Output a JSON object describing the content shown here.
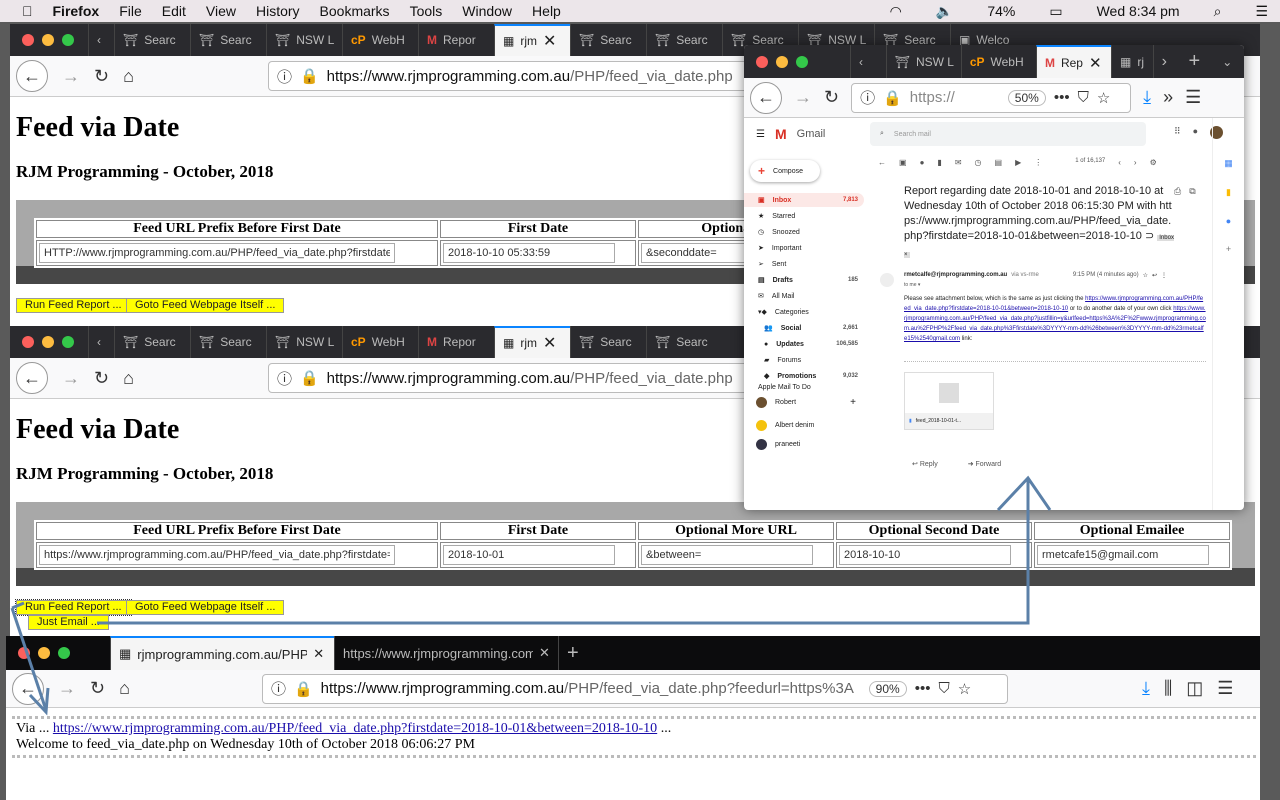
{
  "menubar": {
    "apple": "",
    "app": "Firefox",
    "items": [
      "File",
      "Edit",
      "View",
      "History",
      "Bookmarks",
      "Tools",
      "Window",
      "Help"
    ],
    "battery": "74%",
    "clock": "Wed 8:34 pm"
  },
  "colors": {
    "highlight_buttons": "#ffff00",
    "arrow": "#5b80a8",
    "tabbar": "#2a2a2e",
    "lock": "#12bc00"
  },
  "win1": {
    "tabs": [
      "Searc",
      "Searc",
      "NSW L",
      "WebH",
      "Repor",
      "rjm",
      "Searc",
      "Searc",
      "Searc",
      "NSW L",
      "Searc",
      "Welco"
    ],
    "url_host": "https://www.rjmprogramming.com.au",
    "url_path": "/PHP/feed_via_date.php",
    "title": "Feed via Date",
    "subtitle": "RJM Programming - October, 2018",
    "headers": [
      "Feed URL Prefix Before First Date",
      "First Date",
      "Optional M"
    ],
    "values": [
      "HTTP://www.rjmprogramming.com.au/PHP/feed_via_date.php?firstdate=",
      "2018-10-10 05:33:59",
      "&seconddate="
    ],
    "run": "Run Feed Report ...",
    "goto": "Goto Feed Webpage Itself ..."
  },
  "win2": {
    "tabs": [
      "Searc",
      "Searc",
      "NSW L",
      "WebH",
      "Repor",
      "rjm",
      "Searc",
      "Searc"
    ],
    "url_host": "https://www.rjmprogramming.com.au",
    "url_path": "/PHP/feed_via_date.php",
    "title": "Feed via Date",
    "subtitle": "RJM Programming - October, 2018",
    "headers": [
      "Feed URL Prefix Before First Date",
      "First Date",
      "Optional More URL",
      "Optional Second Date",
      "Optional Emailee"
    ],
    "values": [
      "https://www.rjmprogramming.com.au/PHP/feed_via_date.php?firstdate=",
      "2018-10-01",
      "&between=",
      "2018-10-10",
      "rmetcafe15@gmail.com"
    ],
    "run": "Run Feed Report ...",
    "goto": "Goto Feed Webpage Itself ...",
    "email": "Just Email ..."
  },
  "win3": {
    "tabs": [
      "rjmprogramming.com.au/PHP/fe",
      "https://www.rjmprogramming.com.a"
    ],
    "url_host": "https://www.rjmprogramming.com.au",
    "url_path": "/PHP/feed_via_date.php?feedurl=https%3A",
    "zoom": "90%",
    "via": "Via ...",
    "link": "https://www.rjmprogramming.com.au/PHP/feed_via_date.php?firstdate=2018-10-01&between=2018-10-10",
    "ellipsis": "...",
    "welcome": "Welcome to feed_via_date.php on Wednesday 10th of October 2018 06:06:27 PM"
  },
  "gmail": {
    "tabs": [
      "NSW L",
      "WebH",
      "Rep",
      "rj"
    ],
    "url": "https://",
    "zoom": "50%",
    "brand": "Gmail",
    "search_placeholder": "Search mail",
    "compose": "Compose",
    "nav": [
      {
        "label": "Inbox",
        "count": "7,813"
      },
      {
        "label": "Starred"
      },
      {
        "label": "Snoozed"
      },
      {
        "label": "Important"
      },
      {
        "label": "Sent"
      },
      {
        "label": "Drafts",
        "count": "185"
      },
      {
        "label": "All Mail"
      },
      {
        "label": "Categories"
      },
      {
        "label": "Social",
        "count": "2,661"
      },
      {
        "label": "Updates",
        "count": "106,585"
      },
      {
        "label": "Forums"
      },
      {
        "label": "Promotions",
        "count": "9,032"
      },
      {
        "label": "Apple Mail To Do"
      }
    ],
    "contacts": [
      "Robert",
      "Albert denim",
      "praneeti"
    ],
    "pager": "1 of 16,137",
    "subject": "Report regarding date 2018-10-01 and 2018-10-10 at Wednesday 10th of October 2018 06:15:30 PM with https://www.rjmprogramming.com.au/PHP/feed_via_date.php?firstdate=2018-10-01&between=2018-10-10",
    "label": "Inbox ×",
    "sender": "rmetcalfe@rjmprogramming.com.au",
    "via": "via vs-rme",
    "time": "9:15 PM (4 minutes ago)",
    "to": "to me ▾",
    "body1": "Please see attachment below, which is the same as just clicking the",
    "link1": "https://www.rjmprogramming.com.au/PHP/feed_via_date.php?firstdate=2018-10-01&between=2018-10-10",
    "body2": "or to do another date of your own click",
    "link2": "https://www.rjmprogramming.com.au/PHP/feed_via_date.php?justfillin=y&urlfeed=https%3A%2F%2Fwww.rjmprogramming.com.au%2FPHP%2Ffeed_via_date.php%3Ffirstdate%3DYYYY-mm-dd%26between%3DYYYY-mm-dd%23rmetcalfe15%2540gmail.com",
    "body3": "link:",
    "attachment": "feed_2018-10-01-t...",
    "reply": "Reply",
    "forward": "Forward"
  }
}
